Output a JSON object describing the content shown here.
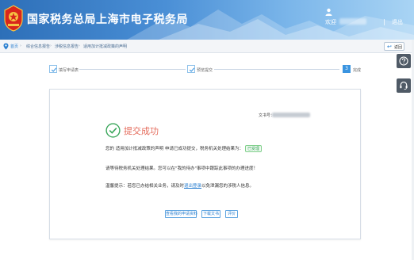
{
  "header": {
    "site_title": "国家税务总局上海市电子税务局",
    "welcome": "欢迎",
    "logout": "退出"
  },
  "breadcrumb": {
    "items": [
      "首页",
      "综合信息报告",
      "涉税信息报告",
      "适用加计抵减政策的声明"
    ],
    "separator": "›",
    "back_label": "返回"
  },
  "steps": {
    "step1": "填写申请表",
    "step2": "预览提交",
    "step3_number": "3",
    "step3": "完成"
  },
  "result": {
    "doc_label": "文书号：",
    "title": "提交成功",
    "line1_prefix": "您的 适用加计抵减政策的声明 申请已成功提交，税务机关处理结果为：",
    "status": "已受理",
    "line2": "请等待税务机关处理结果。您可以在\"我的待办\"事项中跟踪此事项的办理进度！",
    "line3_prefix": "温馨提示：若您已办结相关业务，请及时",
    "line3_link": "退出登录",
    "line3_suffix": "以免泄漏您的涉税人信息。",
    "buttons": {
      "view": "查看我的申请资料",
      "download": "下载文书",
      "evaluate": "评价"
    }
  },
  "colors": {
    "header_blue": "#2d6fb8",
    "success_green": "#3aa65a",
    "title_red": "#e46a5a",
    "link_blue": "#2a7fd0",
    "dock_gray": "#4f5a66"
  },
  "icons": [
    "emblem-icon",
    "user-icon",
    "location-pin-icon",
    "back-arrow-icon",
    "help-icon",
    "headset-icon",
    "check-icon",
    "success-check-icon"
  ]
}
